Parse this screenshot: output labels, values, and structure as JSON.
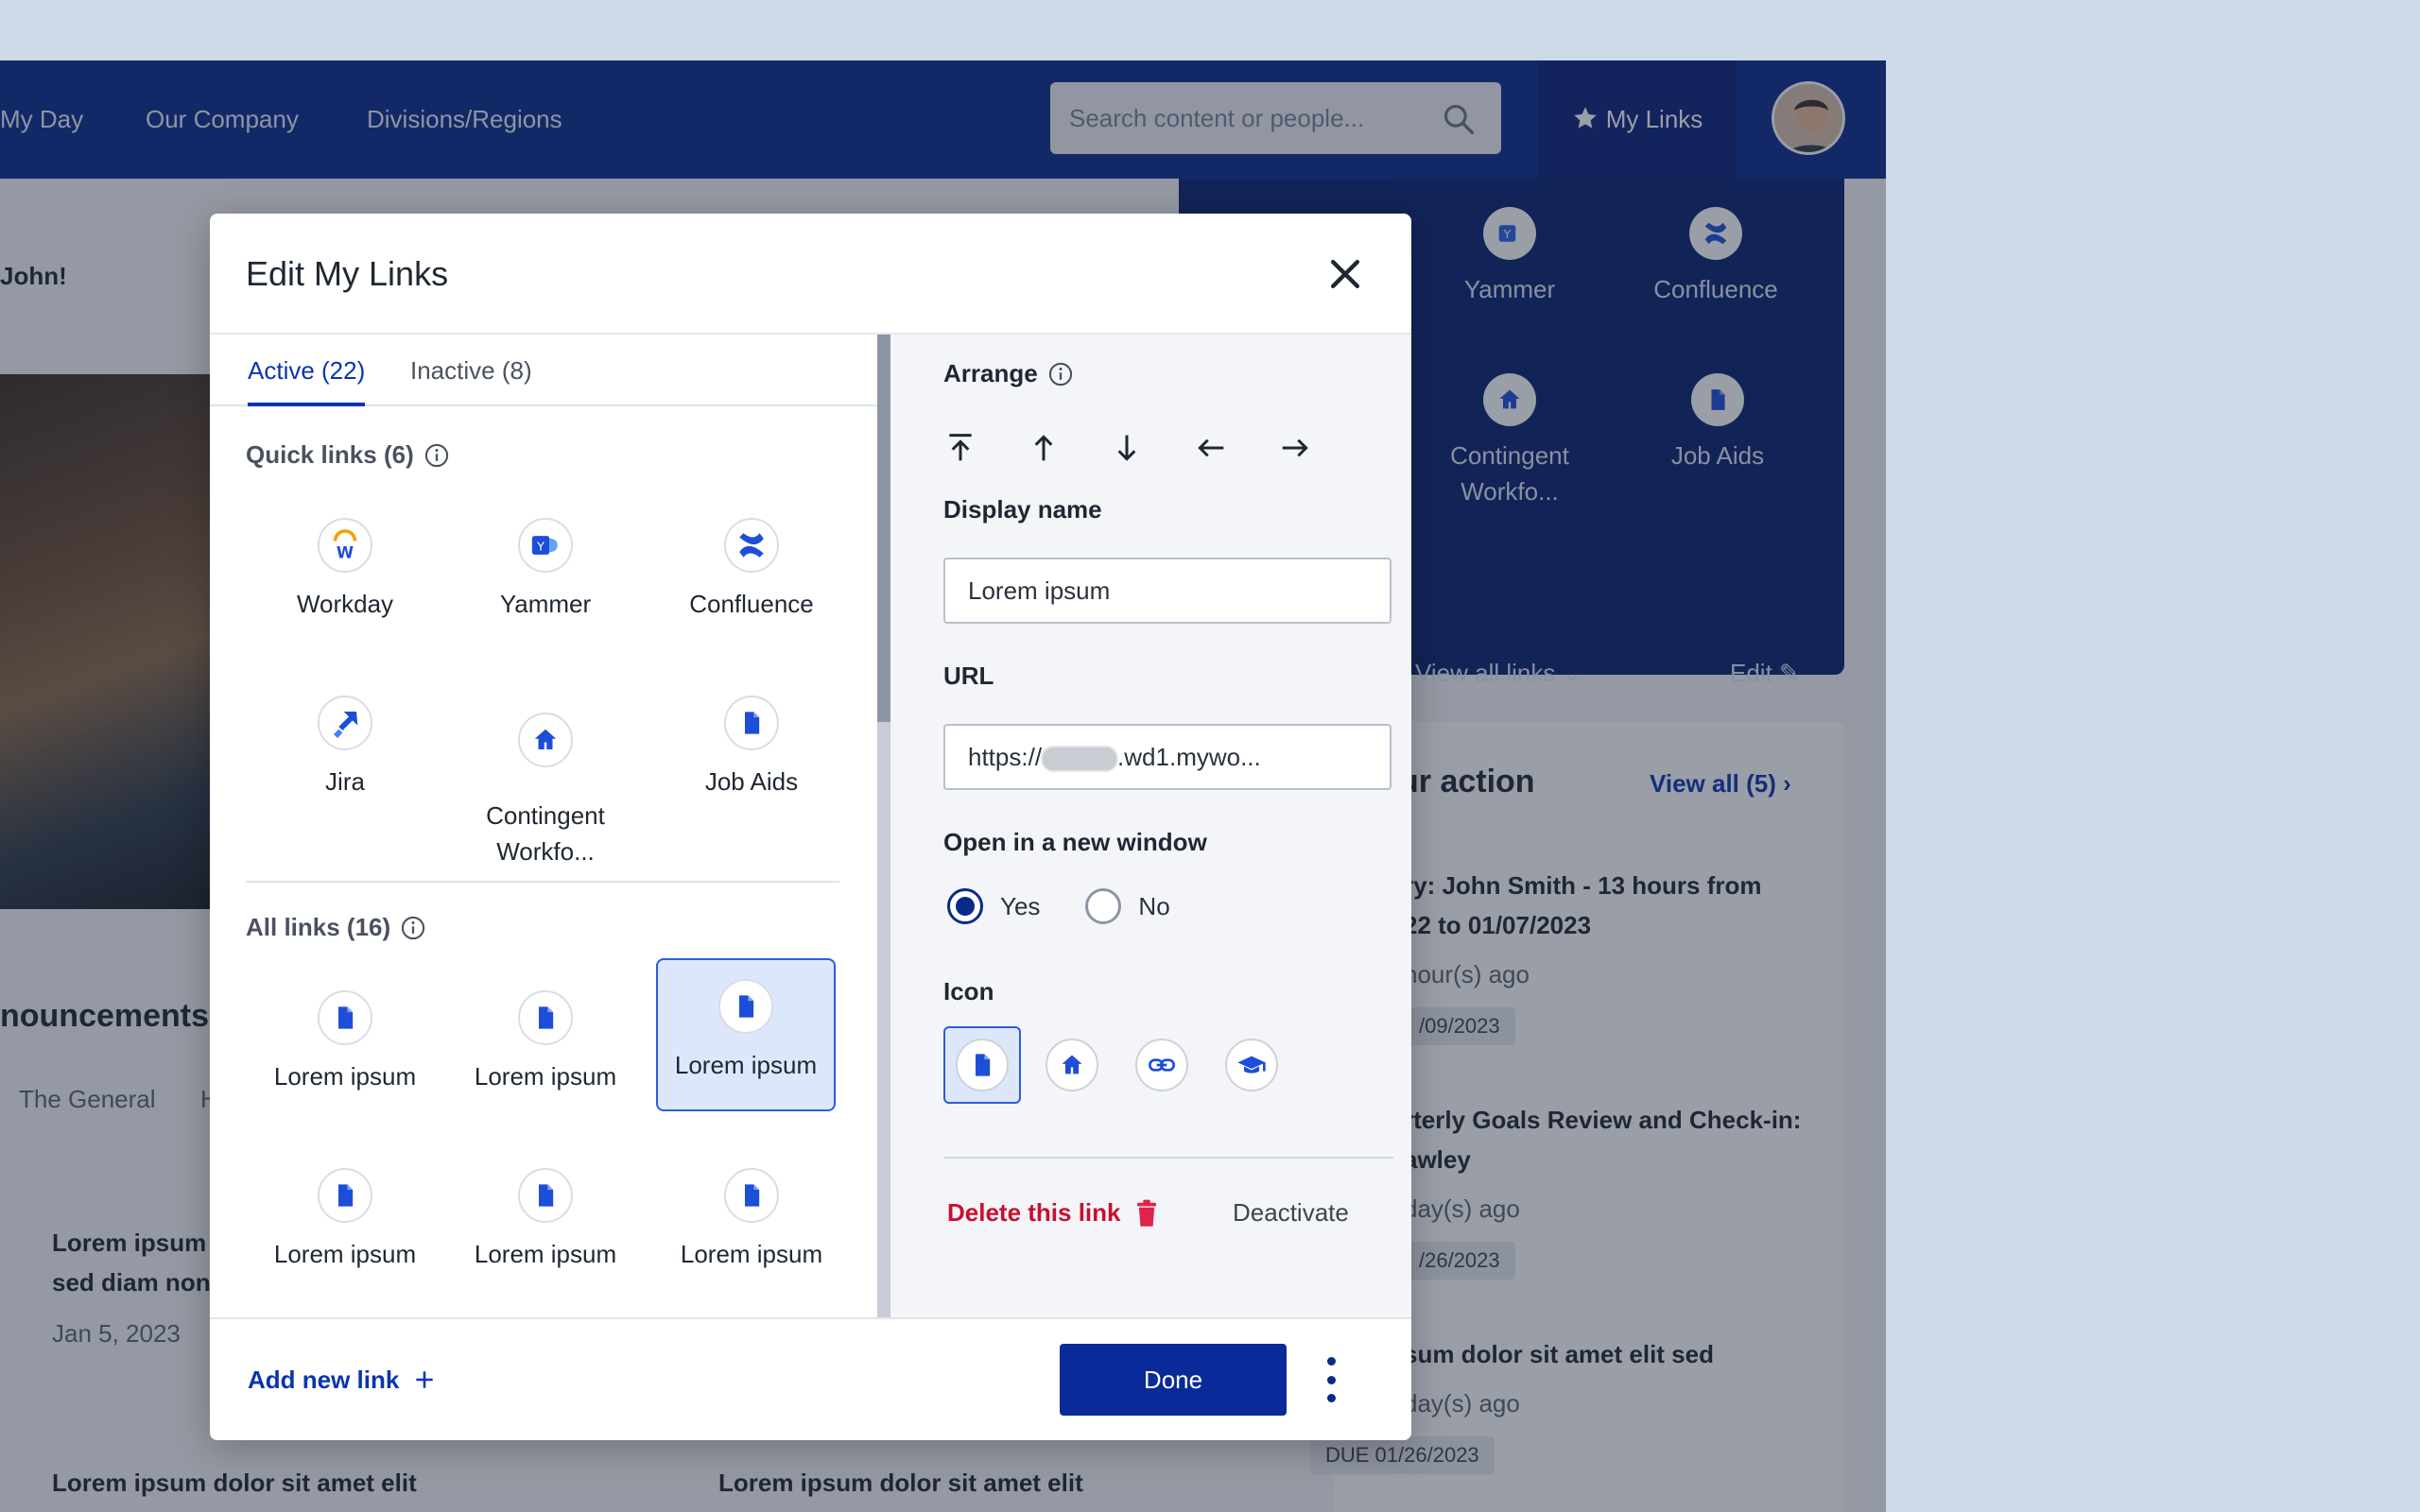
{
  "nav": {
    "items": [
      "My Day",
      "Our Company",
      "Divisions/Regions"
    ],
    "search_placeholder": "Search content or people...",
    "mylinks_label": "My Links"
  },
  "background": {
    "greeting": "John!",
    "announcements": "nouncements",
    "general_tab": "The General",
    "general_tab_trunc": "H",
    "news_title": "Lorem ipsum",
    "news_title2": "sed diam non",
    "news_date": "Jan 5, 2023",
    "news_title3": "Lorem ipsum dolor sit amet elit",
    "news_title4": "Lorem ipsum dolor sit amet elit",
    "panel_links": [
      {
        "label": "Yammer",
        "icon": "yammer-icon"
      },
      {
        "label": "Confluence",
        "icon": "confluence-icon"
      },
      {
        "label": "Contingent\nWorkfo...",
        "icon": "home-icon"
      },
      {
        "label": "Job Aids",
        "icon": "document-icon"
      }
    ],
    "view_all_links": "View all links",
    "edit": "Edit",
    "action_title": "ur action",
    "view_all": "View all (5)",
    "tasks": [
      {
        "line1": "ry: John Smith - 13 hours from",
        "line2": "22 to 01/07/2023",
        "time": "hour(s) ago",
        "due": "/09/2023"
      },
      {
        "line1": "rterly Goals Review and Check-in:",
        "line2": "awley",
        "time": "day(s) ago",
        "due": "/26/2023"
      },
      {
        "line1": "sum dolor sit amet elit sed",
        "line2": "",
        "time": "day(s) ago",
        "due": "DUE 01/26/2023"
      }
    ]
  },
  "modal": {
    "title": "Edit My Links",
    "tabs": [
      {
        "label": "Active (22)",
        "active": true
      },
      {
        "label": "Inactive (8)",
        "active": false
      }
    ],
    "quick_links_label": "Quick links (6)",
    "quick_links": [
      {
        "label": "Workday",
        "icon": "workday-icon"
      },
      {
        "label": "Yammer",
        "icon": "yammer-icon"
      },
      {
        "label": "Confluence",
        "icon": "confluence-icon"
      },
      {
        "label": "Jira",
        "icon": "jira-icon"
      },
      {
        "label": "Contingent\nWorkfo...",
        "icon": "home-icon"
      },
      {
        "label": "Job Aids",
        "icon": "document-icon"
      }
    ],
    "all_links_label": "All links (16)",
    "all_links": [
      {
        "label": "Lorem ipsum",
        "selected": false
      },
      {
        "label": "Lorem ipsum",
        "selected": false
      },
      {
        "label": "Lorem ipsum",
        "selected": true
      },
      {
        "label": "Lorem ipsum",
        "selected": false
      },
      {
        "label": "Lorem ipsum",
        "selected": false
      },
      {
        "label": "Lorem ipsum",
        "selected": false
      }
    ],
    "arrange_label": "Arrange",
    "display_name_label": "Display name",
    "display_name_value": "Lorem ipsum",
    "url_label": "URL",
    "url_prefix": "https://",
    "url_suffix": ".wd1.mywo...",
    "new_window_label": "Open in a new window",
    "radio_yes": "Yes",
    "radio_no": "No",
    "new_window_value": "Yes",
    "icon_label": "Icon",
    "icon_choices": [
      "document-icon",
      "home-icon",
      "link-icon",
      "graduation-cap-icon"
    ],
    "selected_icon": "document-icon",
    "delete_label": "Delete this link",
    "deactivate_label": "Deactivate",
    "add_new_link": "Add new link",
    "done": "Done"
  },
  "colors": {
    "nav_bg": "#0a2a8a",
    "accent": "#0a35b0",
    "danger": "#c8102e",
    "selected_bg": "#dde7fb"
  }
}
